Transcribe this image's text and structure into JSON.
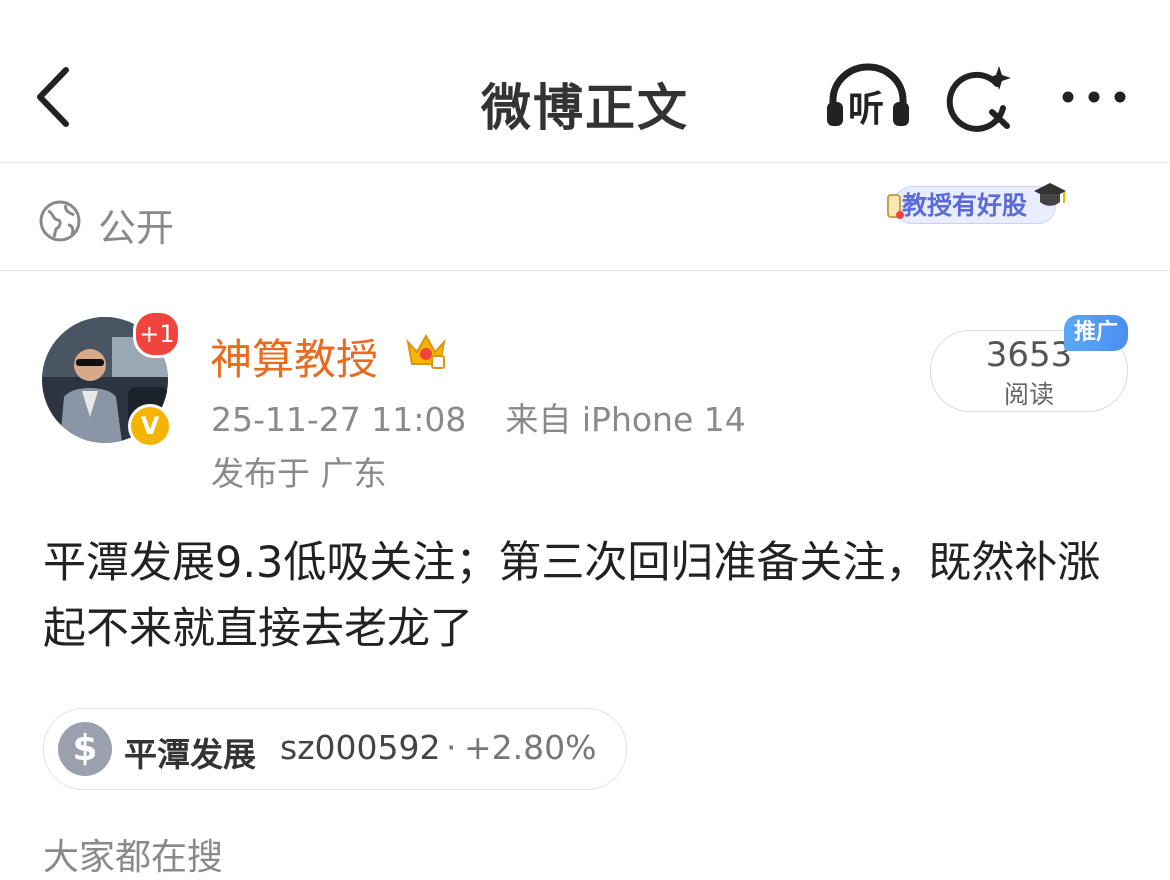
{
  "header": {
    "title": "微博正文",
    "listen_label": "听"
  },
  "visibility": {
    "label": "公开",
    "promo_badge": "教授有好股"
  },
  "post": {
    "avatar_badge": "+1",
    "verified_mark": "V",
    "author": "神算教授",
    "datetime": "25-11-27 11:08",
    "source": "来自 iPhone 14",
    "location": "发布于 广东",
    "reads_count": "3653",
    "reads_label": "阅读",
    "promo_tag": "推广",
    "text": "平潭发展9.3低吸关注；第三次回归准备关注，既然补涨起不来就直接去老龙了"
  },
  "stock": {
    "icon_symbol": "$",
    "name": "平潭发展",
    "code": "sz000592",
    "separator": "·",
    "change": "+2.80%"
  },
  "section": {
    "title": "大家都在搜"
  },
  "colors": {
    "username": "#e86b1f",
    "promo_tag": "#4a8ff2",
    "plus_badge": "#f0443f",
    "verified": "#f5b400"
  }
}
